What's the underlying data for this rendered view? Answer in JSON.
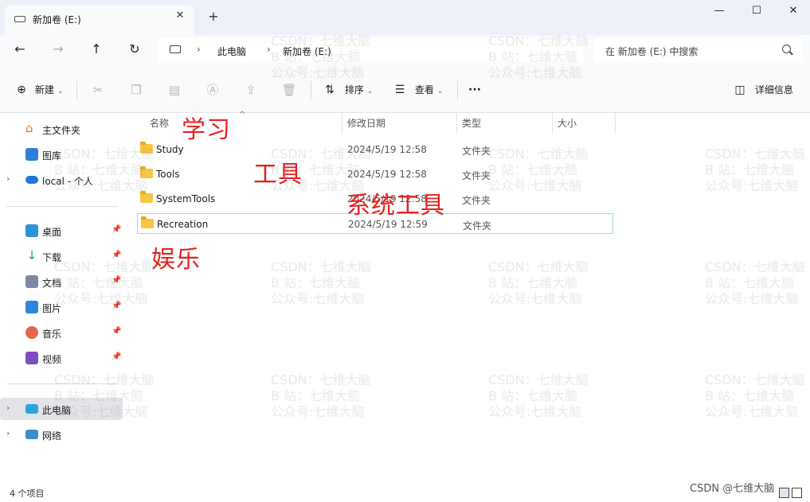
{
  "window": {
    "tab_title": "新加卷 (E:)",
    "tab_close": "✕",
    "new_tab": "+",
    "controls": {
      "minimize": "—",
      "maximize": "☐",
      "close": "✕"
    }
  },
  "address_bar": {
    "breadcrumbs": [
      "此电脑",
      "新加卷 (E:)"
    ],
    "separator": "›",
    "search_placeholder": "在 新加卷 (E:) 中搜索"
  },
  "toolbar": {
    "new_label": "新建",
    "sort_label": "排序",
    "view_label": "查看",
    "more_label": "···",
    "details_label": "详细信息"
  },
  "sidebar": {
    "items": [
      {
        "label": "主文件夹",
        "icon": "home-icon"
      },
      {
        "label": "图库",
        "icon": "gallery-icon"
      },
      {
        "label": "local - 个人",
        "icon": "cloud-icon"
      },
      {
        "label": "桌面",
        "icon": "desktop-icon"
      },
      {
        "label": "下载",
        "icon": "download-icon"
      },
      {
        "label": "文档",
        "icon": "document-icon"
      },
      {
        "label": "图片",
        "icon": "pictures-icon"
      },
      {
        "label": "音乐",
        "icon": "music-icon"
      },
      {
        "label": "视频",
        "icon": "video-icon"
      },
      {
        "label": "此电脑",
        "icon": "computer-icon"
      },
      {
        "label": "网络",
        "icon": "network-icon"
      }
    ]
  },
  "columns": {
    "name": "名称",
    "modified": "修改日期",
    "type": "类型",
    "size": "大小"
  },
  "files": [
    {
      "name": "Study",
      "modified": "2024/5/19 12:58",
      "type": "文件夹"
    },
    {
      "name": "Tools",
      "modified": "2024/5/19 12:58",
      "type": "文件夹"
    },
    {
      "name": "SystemTools",
      "modified": "2024/5/19 12:58",
      "type": "文件夹"
    },
    {
      "name": "Recreation",
      "modified": "2024/5/19 12:59",
      "type": "文件夹"
    }
  ],
  "annotations": {
    "study": "学习",
    "tools": "工具",
    "system_tools": "系统工具",
    "recreation": "娱乐"
  },
  "status": {
    "item_count": "4 个项目"
  },
  "watermark": {
    "line1": "CSDN：七维大脑",
    "line2": "B 站：七维大脑",
    "line3": "公众号:七维大脑",
    "credit": "CSDN @七维大脑"
  },
  "colors": {
    "annotation": "#e82020",
    "folder": "#f8c443",
    "selection_border": "#99d9ea"
  }
}
